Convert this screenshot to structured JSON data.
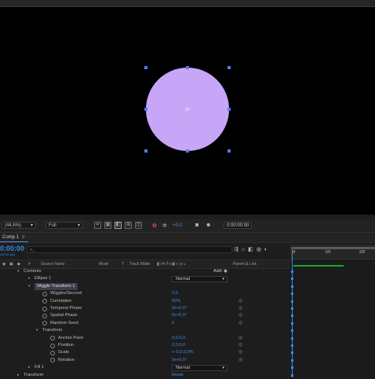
{
  "viewer": {
    "ellipse_color": "#c7a6f7",
    "handle_color": "#5577ff",
    "zoom": "(44,6%)",
    "resolution": "Full",
    "exposure": "+0,0",
    "current_time": "0:00:00:00"
  },
  "timeline": {
    "tab_label": "Comp 1",
    "timecode": "0:00:00",
    "fps": "(30.00 fps)",
    "search_placeholder": "⌕⌄",
    "columns": {
      "source_name": "Source Name",
      "mode": "Mode",
      "t": "T",
      "track_matte": "Track Matte",
      "parent_link": "Parent & Link"
    },
    "ruler_ticks": [
      "0f",
      "10f",
      "20f"
    ],
    "rows": [
      {
        "label": "Contents",
        "indent": 30,
        "twirl": "▾",
        "extra": "Add:",
        "type": "group"
      },
      {
        "label": "Ellipse 1",
        "indent": 44,
        "twirl": "▸",
        "dropdown": "Normal",
        "type": "group"
      },
      {
        "label": "Wiggle Transform 1",
        "indent": 44,
        "twirl": "▾",
        "type": "selected"
      },
      {
        "label": "Wiggles/Second",
        "indent": 64,
        "value": "2,0",
        "type": "prop"
      },
      {
        "label": "Correlation",
        "indent": 64,
        "value": "50%",
        "type": "prop",
        "control": "@"
      },
      {
        "label": "Temporal Phase",
        "indent": 64,
        "value": "0x+0,0°",
        "type": "prop",
        "control": "@"
      },
      {
        "label": "Spatial Phase",
        "indent": 64,
        "value": "0x+0,0°",
        "type": "prop",
        "control": "@"
      },
      {
        "label": "Random Seed",
        "indent": 64,
        "value": "0",
        "type": "prop",
        "control": "@"
      },
      {
        "label": "Transform",
        "indent": 54,
        "twirl": "▾",
        "type": "group"
      },
      {
        "label": "Anchor Point",
        "indent": 74,
        "value": "0,0,0,0",
        "type": "prop",
        "control": "@"
      },
      {
        "label": "Position",
        "indent": 74,
        "value": "0,0,0,0",
        "type": "prop",
        "control": "@"
      },
      {
        "label": "Scale",
        "indent": 74,
        "value": "∞ 0,0,0,0%",
        "type": "prop",
        "control": "@"
      },
      {
        "label": "Rotation",
        "indent": 74,
        "value": "0x+0,0°",
        "type": "prop",
        "control": "@"
      },
      {
        "label": "Fill 1",
        "indent": 44,
        "twirl": "▸",
        "dropdown": "Normal",
        "type": "group"
      },
      {
        "label": "Transform",
        "indent": 30,
        "twirl": "▸",
        "value": "Reset",
        "type": "group"
      }
    ]
  }
}
